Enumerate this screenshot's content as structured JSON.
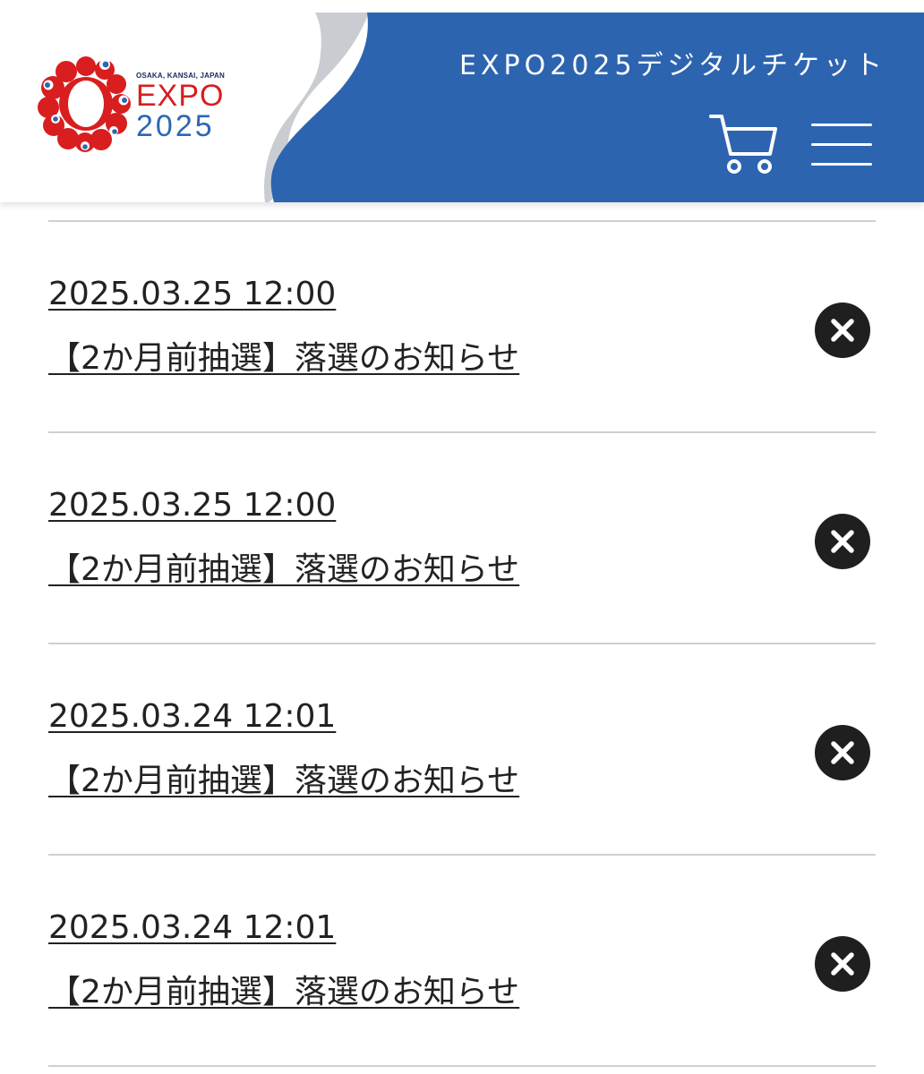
{
  "header": {
    "site_title": "EXPO2025デジタルチケット",
    "logo": {
      "subtitle": "OSAKA, KANSAI, JAPAN",
      "wordmark": "EXPO",
      "year": "2025"
    },
    "cart_icon": "cart-icon",
    "menu_icon": "hamburger-menu-icon"
  },
  "colors": {
    "header_blue": "#2d64b0",
    "wave_gray": "#c9ccd1",
    "logo_red": "#d81e1e",
    "logo_blue": "#2c67b2",
    "text": "#222222",
    "divider": "#cfcfcf",
    "close_button": "#1f1f1f"
  },
  "notifications": [
    {
      "date": "2025.03.25 12:00",
      "title": "【2か月前抽選】落選のお知らせ"
    },
    {
      "date": "2025.03.25 12:00",
      "title": "【2か月前抽選】落選のお知らせ"
    },
    {
      "date": "2025.03.24 12:01",
      "title": "【2か月前抽選】落選のお知らせ"
    },
    {
      "date": "2025.03.24 12:01",
      "title": "【2か月前抽選】落選のお知らせ"
    }
  ]
}
